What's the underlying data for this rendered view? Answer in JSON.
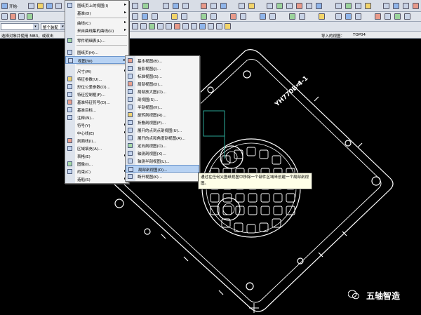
{
  "toolbar": {
    "start_label": "开始·",
    "view_filter_placeholder": "",
    "drawing_scope_label": "整个装配"
  },
  "selection_bar": {
    "left_text": "选择对象并使用 MB3，或双击",
    "right_label": "导入的视图：",
    "right_value": "TOP04"
  },
  "insert_menu": {
    "items": [
      {
        "label": "图纸页上的视图(I)",
        "has_sub": true
      },
      {
        "label": "基准(D)",
        "has_sub": true
      },
      {
        "label": "曲线(C)",
        "has_sub": true
      },
      {
        "label": "来自曲线集的曲线(U)",
        "has_sub": true
      },
      {
        "label": "零件明细表(L)...",
        "has_sub": false
      },
      {
        "label": "图纸页(H)...",
        "has_sub": false
      },
      {
        "label": "视图(W)",
        "has_sub": true
      },
      {
        "label": "尺寸(M)",
        "has_sub": true
      },
      {
        "label": "特征参数(U)...",
        "has_sub": false
      },
      {
        "label": "形位公差参数(O)...",
        "has_sub": false
      },
      {
        "label": "特征控制框(F)...",
        "has_sub": false
      },
      {
        "label": "基准特征符号(D)...",
        "has_sub": false
      },
      {
        "label": "基准目标...",
        "has_sub": false
      },
      {
        "label": "注释(N)...",
        "has_sub": false
      },
      {
        "label": "符号(Y)",
        "has_sub": true
      },
      {
        "label": "中心线(E)",
        "has_sub": true
      },
      {
        "label": "剖面线(I)...",
        "has_sub": false
      },
      {
        "label": "区域填充(A)...",
        "has_sub": false
      },
      {
        "label": "表格(E)",
        "has_sub": true
      },
      {
        "label": "图像(I)...",
        "has_sub": false
      },
      {
        "label": "约束(C)",
        "has_sub": true
      },
      {
        "label": "造船(S)",
        "has_sub": true
      }
    ]
  },
  "view_menu": {
    "items": [
      {
        "label": "基本视图(B)..."
      },
      {
        "label": "投影视图(J)..."
      },
      {
        "label": "标准视图(S)..."
      },
      {
        "label": "局部视图(D)..."
      },
      {
        "label": "局部放大图(D)..."
      },
      {
        "label": "剖视图(S)..."
      },
      {
        "label": "半剖视图(H)..."
      },
      {
        "label": "旋转剖视图(R)..."
      },
      {
        "label": "折叠剖视图(F)..."
      },
      {
        "label": "展开的点到点剖视图(U)..."
      },
      {
        "label": "展开的点和角度剖视图(A)..."
      },
      {
        "label": "定向剖视图(O)..."
      },
      {
        "label": "轴测剖视图(X)..."
      },
      {
        "label": "轴测半剖视图(L)..."
      },
      {
        "label": "局部剖视图(O)..."
      },
      {
        "label": "断开视图(K)..."
      }
    ]
  },
  "tooltip": {
    "text": "通过在任何父图纸视图中移除一个部件区域来创建一个局部剖视图。"
  },
  "drawing": {
    "part_label": "YH770B-4-1"
  },
  "watermark": {
    "text": "五轴智造"
  },
  "colors": {
    "toolbar_bg": "#d8dde6",
    "menu_bg": "#f4f4f4",
    "menu_highlight": "#b7d2f3",
    "canvas_bg": "#000000",
    "geometry": "#ffffff",
    "view_border": "#2fb7a3"
  }
}
